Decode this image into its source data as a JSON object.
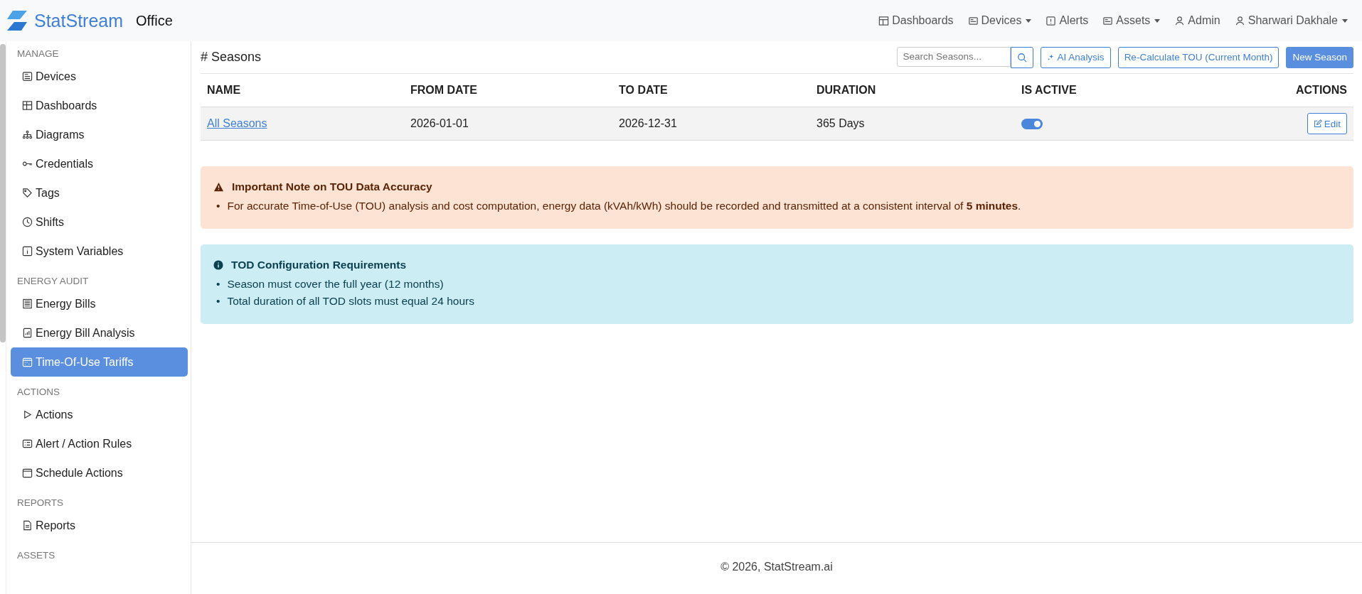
{
  "brand": {
    "name": "StatStream",
    "workspace": "Office"
  },
  "nav": [
    {
      "label": "Dashboards",
      "dropdown": false
    },
    {
      "label": "Devices",
      "dropdown": true
    },
    {
      "label": "Alerts",
      "dropdown": false
    },
    {
      "label": "Assets",
      "dropdown": true
    },
    {
      "label": "Admin",
      "dropdown": false
    },
    {
      "label": "Sharwari Dakhale",
      "dropdown": true
    }
  ],
  "sidebar": {
    "sections": [
      {
        "title": "MANAGE",
        "items": [
          {
            "label": "Devices",
            "selected": false
          },
          {
            "label": "Dashboards",
            "selected": false
          },
          {
            "label": "Diagrams",
            "selected": false
          },
          {
            "label": "Credentials",
            "selected": false
          },
          {
            "label": "Tags",
            "selected": false
          },
          {
            "label": "Shifts",
            "selected": false
          },
          {
            "label": "System Variables",
            "selected": false
          }
        ]
      },
      {
        "title": "ENERGY AUDIT",
        "items": [
          {
            "label": "Energy Bills",
            "selected": false
          },
          {
            "label": "Energy Bill Analysis",
            "selected": false
          },
          {
            "label": "Time-Of-Use Tariffs",
            "selected": true
          }
        ]
      },
      {
        "title": "ACTIONS",
        "items": [
          {
            "label": "Actions",
            "selected": false
          },
          {
            "label": "Alert / Action Rules",
            "selected": false
          },
          {
            "label": "Schedule Actions",
            "selected": false
          }
        ]
      },
      {
        "title": "REPORTS",
        "items": [
          {
            "label": "Reports",
            "selected": false
          }
        ]
      },
      {
        "title": "ASSETS"
      }
    ]
  },
  "page": {
    "title": "# Seasons",
    "search": {
      "placeholder": "Search Seasons..."
    },
    "buttons": [
      {
        "label": "AI Analysis",
        "kind": "outline"
      },
      {
        "label": "Re-Calculate TOU (Current Month)",
        "kind": "outline"
      },
      {
        "label": "New Season",
        "kind": "primary"
      }
    ]
  },
  "table": {
    "columns": [
      "NAME",
      "FROM DATE",
      "TO DATE",
      "DURATION",
      "IS ACTIVE",
      "ACTIONS"
    ],
    "rows": [
      {
        "name": "All Seasons",
        "from": "2026-01-01",
        "to": "2026-12-31",
        "duration": "365 Days",
        "active": true,
        "action": "Edit"
      }
    ]
  },
  "notes": [
    {
      "kind": "warning",
      "marker": "•",
      "title": "Important Note on TOU Data Accuracy",
      "items": [
        "For accurate Time-of-Use (TOU) analysis and cost computation, energy data (kVAh/kWh) should be recorded and transmitted at a consistent interval of **5 minutes**."
      ]
    },
    {
      "kind": "info",
      "marker": "•",
      "title": "TOD Configuration Requirements",
      "items": [
        "Season must cover the full year (12 months)",
        "Total duration of all TOD slots must equal 24 hours"
      ]
    }
  ],
  "footer": "© 2026, StatStream.ai"
}
